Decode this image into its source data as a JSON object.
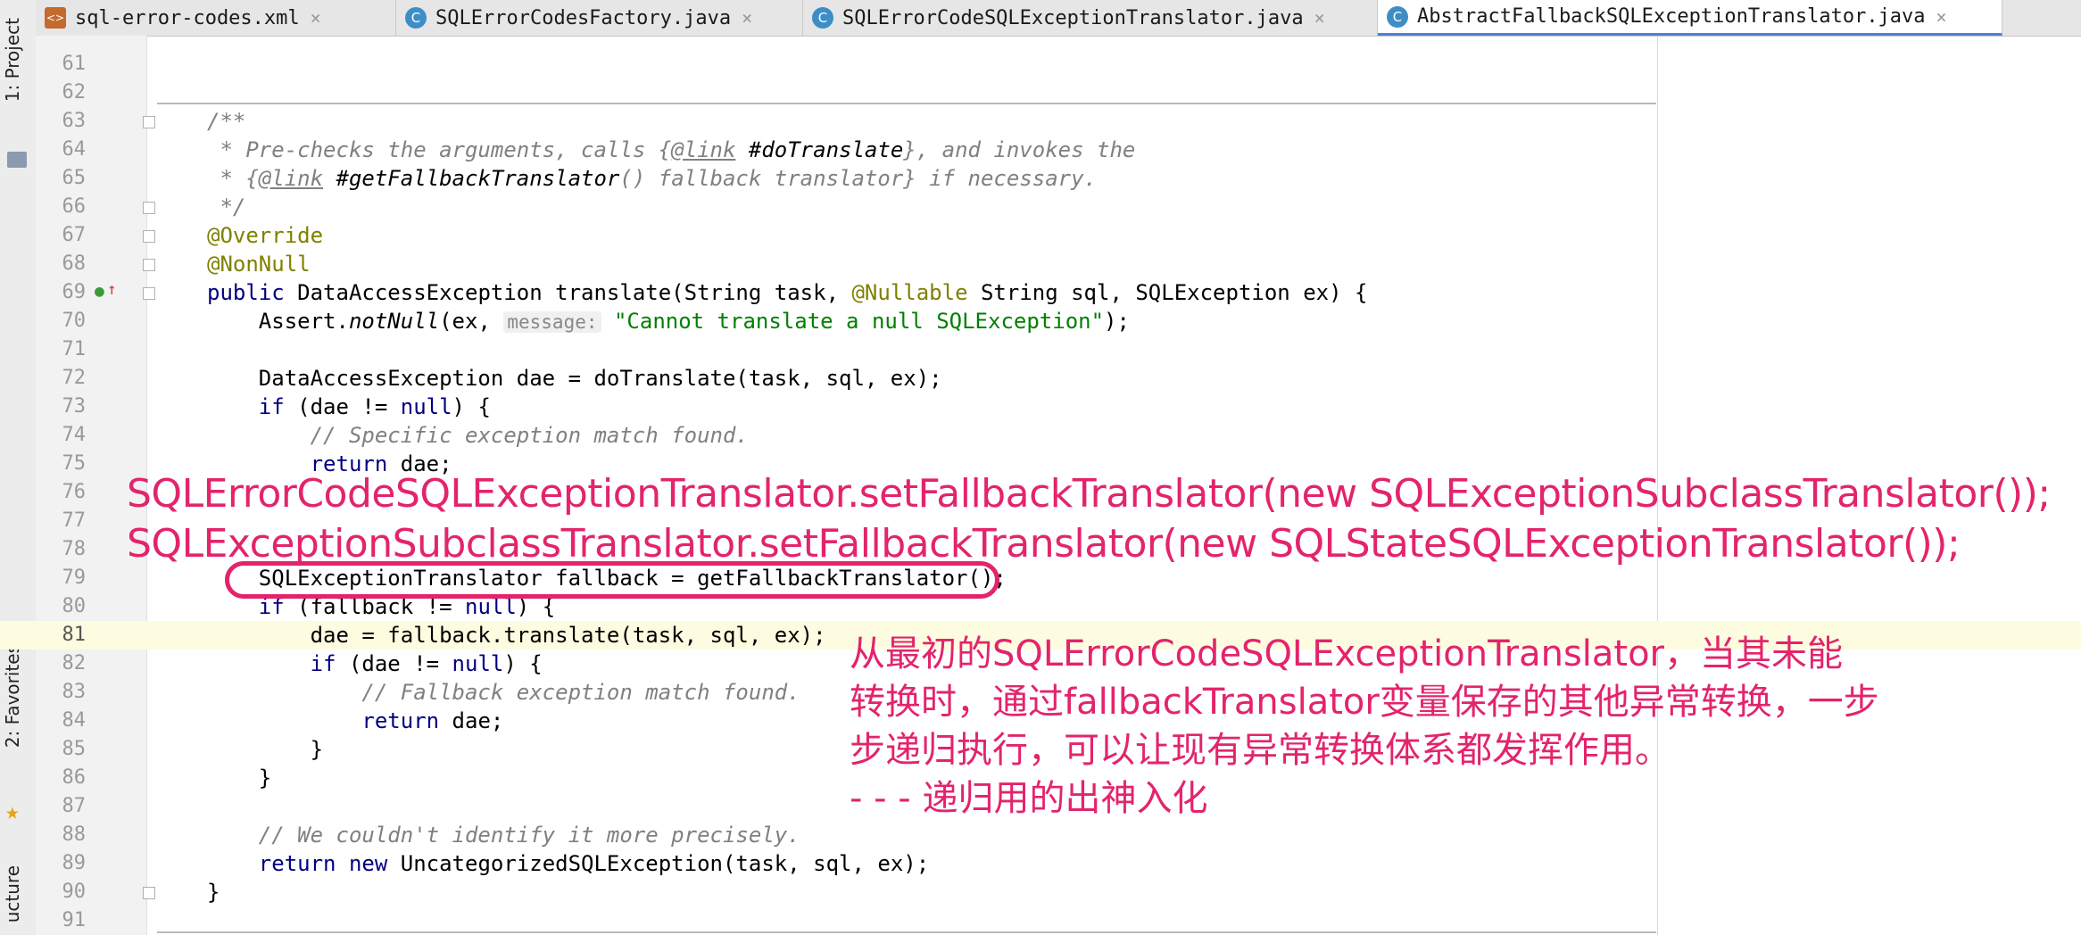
{
  "side_panel": {
    "project": "1: Project",
    "favorites": "2: Favorites",
    "structure": "ucture"
  },
  "tabs": [
    {
      "label": "sql-error-codes.xml",
      "icon": "xml-file-icon"
    },
    {
      "label": "SQLErrorCodesFactory.java",
      "icon": "class-icon"
    },
    {
      "label": "SQLErrorCodeSQLExceptionTranslator.java",
      "icon": "class-icon"
    },
    {
      "label": "AbstractFallbackSQLExceptionTranslator.java",
      "icon": "class-icon",
      "active": true
    }
  ],
  "line_numbers": [
    "61",
    "62",
    "63",
    "64",
    "65",
    "66",
    "67",
    "68",
    "69",
    "70",
    "71",
    "72",
    "73",
    "74",
    "75",
    "76",
    "77",
    "78",
    "79",
    "80",
    "81",
    "82",
    "83",
    "84",
    "85",
    "86",
    "87",
    "88",
    "89",
    "90",
    "91"
  ],
  "code": {
    "l63": "/**",
    "l64a": " * Pre-checks the arguments, calls {",
    "l64b": "@link",
    "l64c": " #doTranslate",
    "l64d": "}, and invokes the",
    "l65a": " * {",
    "l65b": "@link",
    "l65c": " #getFallbackTranslator",
    "l65d": "() fallback translator} if necessary.",
    "l66": " */",
    "l67": "@Override",
    "l68": "@NonNull",
    "l69a": "public",
    "l69b": " DataAccessException translate(String task, ",
    "l69c": "@Nullable",
    "l69d": " String sql, SQLException ex) {",
    "l70a": "    Assert.",
    "l70b": "notNull",
    "l70c": "(ex, ",
    "l70hint": "message:",
    "l70d": " \"Cannot translate a null SQLException\"",
    "l70e": ");",
    "l72": "    DataAccessException dae = doTranslate(task, sql, ex);",
    "l73a": "    ",
    "l73b": "if",
    "l73c": " (dae != ",
    "l73d": "null",
    "l73e": ") {",
    "l74": "        // Specific exception match found.",
    "l75a": "        ",
    "l75b": "return",
    "l75c": " dae;",
    "l79": "    SQLExceptionTranslator fallback = getFallbackTranslator();",
    "l80a": "    ",
    "l80b": "if",
    "l80c": " (fallback != ",
    "l80d": "null",
    "l80e": ") {",
    "l81": "        dae = fallback.translate(task, sql, ex);",
    "l82a": "        ",
    "l82b": "if",
    "l82c": " (dae != ",
    "l82d": "null",
    "l82e": ") {",
    "l83": "            // Fallback exception match found.",
    "l84a": "            ",
    "l84b": "return",
    "l84c": " dae;",
    "l85": "        }",
    "l86": "    }",
    "l88": "    // We couldn't identify it more precisely.",
    "l89a": "    ",
    "l89b": "return new",
    "l89c": " UncategorizedSQLException(task, sql, ex);",
    "l90": "}"
  },
  "overlay": {
    "line1": "SQLErrorCodeSQLExceptionTranslator.setFallbackTranslator(new SQLExceptionSubclassTranslator());",
    "line2": "SQLExceptionSubclassTranslator.setFallbackTranslator(new SQLStateSQLExceptionTranslator());",
    "note1": "从最初的SQLErrorCodeSQLExceptionTranslator，当其未能",
    "note2": "转换时，通过fallbackTranslator变量保存的其他异常转换，一步",
    "note3": "步递归执行，可以让现有异常转换体系都发挥作用。",
    "note4": "- - - 递归用的出神入化"
  },
  "colors": {
    "annotation": "#e3246b",
    "keyword": "#000080",
    "string": "#008000",
    "comment": "#808080"
  }
}
